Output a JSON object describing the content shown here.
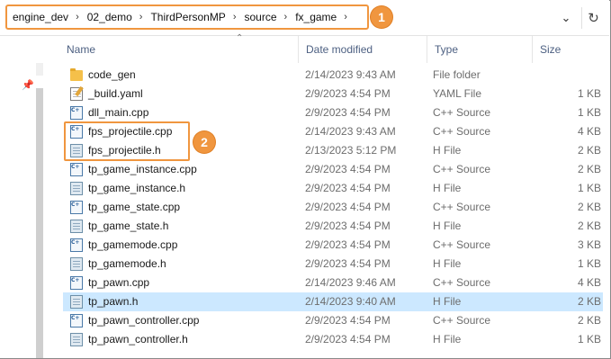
{
  "address_bar": {
    "crumbs": [
      "engine_dev",
      "02_demo",
      "ThirdPersonMP",
      "source",
      "fx_game"
    ],
    "dropdown_icon": "chevron-down-icon",
    "refresh_icon": "refresh-icon"
  },
  "badges": {
    "one": "1",
    "two": "2"
  },
  "columns": {
    "name": "Name",
    "date": "Date modified",
    "type": "Type",
    "size": "Size"
  },
  "files": [
    {
      "name": "code_gen",
      "date": "2/14/2023 9:43 AM",
      "type": "File folder",
      "size": "",
      "icon": "folder-icon"
    },
    {
      "name": "_build.yaml",
      "date": "2/9/2023 4:54 PM",
      "type": "YAML File",
      "size": "1 KB",
      "icon": "yaml-file-icon"
    },
    {
      "name": "dll_main.cpp",
      "date": "2/9/2023 4:54 PM",
      "type": "C++ Source",
      "size": "1 KB",
      "icon": "cpp-file-icon"
    },
    {
      "name": "fps_projectile.cpp",
      "date": "2/14/2023 9:43 AM",
      "type": "C++ Source",
      "size": "4 KB",
      "icon": "cpp-file-icon"
    },
    {
      "name": "fps_projectile.h",
      "date": "2/13/2023 5:12 PM",
      "type": "H File",
      "size": "2 KB",
      "icon": "h-file-icon"
    },
    {
      "name": "tp_game_instance.cpp",
      "date": "2/9/2023 4:54 PM",
      "type": "C++ Source",
      "size": "2 KB",
      "icon": "cpp-file-icon"
    },
    {
      "name": "tp_game_instance.h",
      "date": "2/9/2023 4:54 PM",
      "type": "H File",
      "size": "1 KB",
      "icon": "h-file-icon"
    },
    {
      "name": "tp_game_state.cpp",
      "date": "2/9/2023 4:54 PM",
      "type": "C++ Source",
      "size": "2 KB",
      "icon": "cpp-file-icon"
    },
    {
      "name": "tp_game_state.h",
      "date": "2/9/2023 4:54 PM",
      "type": "H File",
      "size": "2 KB",
      "icon": "h-file-icon"
    },
    {
      "name": "tp_gamemode.cpp",
      "date": "2/9/2023 4:54 PM",
      "type": "C++ Source",
      "size": "3 KB",
      "icon": "cpp-file-icon"
    },
    {
      "name": "tp_gamemode.h",
      "date": "2/9/2023 4:54 PM",
      "type": "H File",
      "size": "1 KB",
      "icon": "h-file-icon"
    },
    {
      "name": "tp_pawn.cpp",
      "date": "2/14/2023 9:46 AM",
      "type": "C++ Source",
      "size": "4 KB",
      "icon": "cpp-file-icon"
    },
    {
      "name": "tp_pawn.h",
      "date": "2/14/2023 9:40 AM",
      "type": "H File",
      "size": "2 KB",
      "icon": "h-file-icon",
      "selected": true
    },
    {
      "name": "tp_pawn_controller.cpp",
      "date": "2/9/2023 4:54 PM",
      "type": "C++ Source",
      "size": "2 KB",
      "icon": "cpp-file-icon"
    },
    {
      "name": "tp_pawn_controller.h",
      "date": "2/9/2023 4:54 PM",
      "type": "H File",
      "size": "1 KB",
      "icon": "h-file-icon"
    }
  ],
  "colors": {
    "highlight": "#f0963f",
    "selection": "#cce8ff",
    "header_text": "#4d6082"
  }
}
